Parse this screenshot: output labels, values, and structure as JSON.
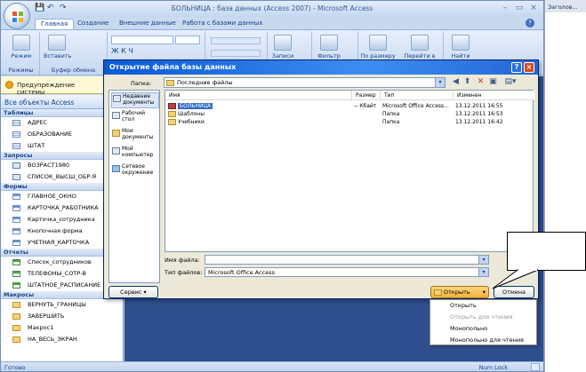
{
  "app": {
    "title": "БОЛЬНИЦА : база данных (Access 2007) - Microsoft Access",
    "window_controls": [
      "–",
      "▭",
      "×"
    ],
    "tabs": [
      "Главная",
      "Создание",
      "Внешние данные",
      "Работа с базами данных"
    ],
    "ribbon_groups": [
      {
        "name": "Режимы",
        "button": "Режим"
      },
      {
        "name": "Буфер обмена",
        "button": "Вставить"
      },
      {
        "name": "",
        "button": ""
      },
      {
        "name": "",
        "button": ""
      },
      {
        "name": "",
        "button": "Записи"
      },
      {
        "name": "",
        "button": "Фильтр"
      },
      {
        "name": "",
        "button": "По размеру"
      },
      {
        "name": "",
        "button": "Перейти в"
      },
      {
        "name": "",
        "button": "Найти"
      }
    ],
    "status": "Готово",
    "numlock": "Num Lock"
  },
  "security_warning": "Предупреждение системы",
  "nav": {
    "header": "Все объекты Access",
    "groups": [
      {
        "label": "Таблицы",
        "kind": "table",
        "items": [
          "АДРЕС",
          "ОБРАЗОВАНИЕ",
          "ШТАТ"
        ]
      },
      {
        "label": "Запросы",
        "kind": "query",
        "items": [
          "ВОЗРАСТ1980",
          "СПИСОК_ВЫСШ_ОБР-Я"
        ]
      },
      {
        "label": "Формы",
        "kind": "form",
        "items": [
          "ГЛАВНОЕ_ОКНО",
          "КАРТОЧКА_РАБОТНИКА",
          "Карточка_сотрудника",
          "Кнопочная форма",
          "УЧЕТНАЯ_КАРТОЧКА"
        ]
      },
      {
        "label": "Отчеты",
        "kind": "report",
        "items": [
          "Список_сотрудников",
          "ТЕЛЕФОНЫ_СОТР-В",
          "ШТАТНОЕ_РАСПИСАНИЕ"
        ]
      },
      {
        "label": "Макросы",
        "kind": "macro",
        "items": [
          "ВЕРНУТЬ_ГРАНИЦЫ",
          "ЗАВЕРШИТЬ",
          "Макрос1",
          "НА_ВЕСЬ_ЭКРАН"
        ]
      }
    ]
  },
  "right_window_title": "Заголов...",
  "dialog": {
    "title": "Открытие файла базы данных",
    "look_in_label": "Папка:",
    "look_in_value": "Последние файлы",
    "places": [
      "Недавние документы",
      "Рабочий стол",
      "Мои документы",
      "Мой компьютер",
      "Сетевое окружение"
    ],
    "columns": [
      "Имя",
      "Размер",
      "Тип",
      "Изменен"
    ],
    "files": [
      {
        "name": "БОЛЬНИЦА",
        "size": "-- Кбайт",
        "type": "Microsoft Office Access...",
        "modified": "13.12.2011 16:55",
        "icon": "db"
      },
      {
        "name": "Шаблоны",
        "size": "",
        "type": "Папка",
        "modified": "13.12.2011 16:53",
        "icon": "folder"
      },
      {
        "name": "Учебники",
        "size": "",
        "type": "Папка",
        "modified": "13.12.2011 16:42",
        "icon": "folder"
      }
    ],
    "filename_label": "Имя файла:",
    "filename_value": "",
    "filetype_label": "Тип файлов:",
    "filetype_value": "Microsoft Office Access",
    "service_button": "Сервис",
    "open_button": "Открыть",
    "cancel_button": "Отмена",
    "open_menu": [
      "Открыть",
      "Открыть для чтения",
      "Монопольно",
      "Монопольно для чтения"
    ]
  },
  "colors": {
    "ribbon_blue": "#c7d9f1",
    "workarea": "#2f4e8d",
    "dialog_title": "#0a59d6",
    "selection": "#316ac5"
  }
}
